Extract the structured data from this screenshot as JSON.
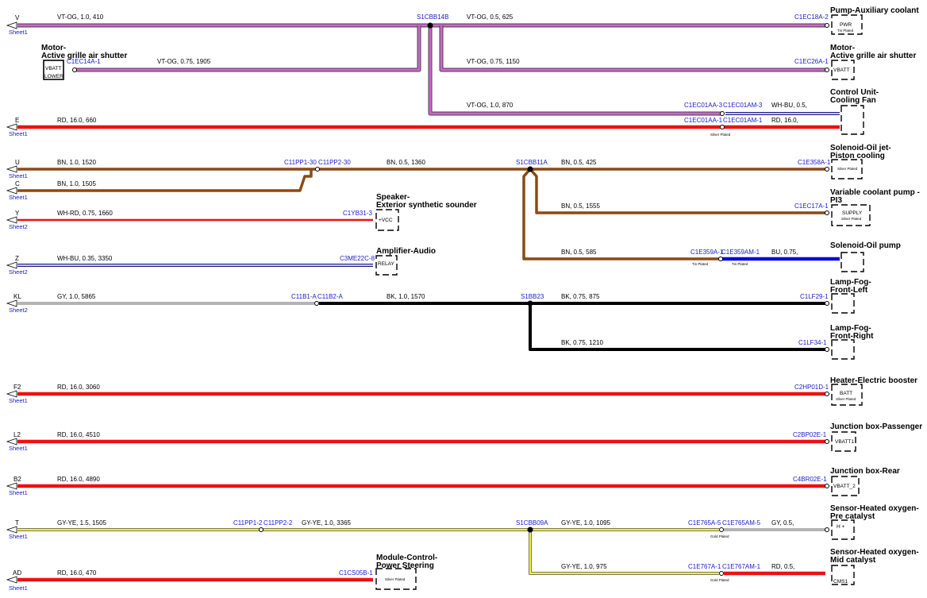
{
  "sheets": [
    "Sheet1",
    "Sheet2"
  ],
  "circuits": [
    {
      "letter": "V",
      "sheet": "Sheet1",
      "wire": "VT-OG, 1.0, 410"
    },
    {
      "letter": "E",
      "sheet": "Sheet1",
      "wire": "RD, 16.0, 660"
    },
    {
      "letter": "U",
      "sheet": "Sheet1",
      "wire": "BN, 1.0, 1520"
    },
    {
      "letter": "C",
      "sheet": "Sheet1",
      "wire": "BN, 1.0, 1505"
    },
    {
      "letter": "Y",
      "sheet": "Sheet2",
      "wire": "WH-RD, 0.75, 1660"
    },
    {
      "letter": "Z",
      "sheet": "Sheet2",
      "wire": "WH-BU, 0.35, 3350"
    },
    {
      "letter": "KL",
      "sheet": "Sheet2",
      "wire": "GY, 1.0, 5865"
    },
    {
      "letter": "F2",
      "sheet": "Sheet1",
      "wire": "RD, 16.0, 3060"
    },
    {
      "letter": "L2",
      "sheet": "Sheet1",
      "wire": "RD, 16.0, 4510"
    },
    {
      "letter": "B2",
      "sheet": "Sheet1",
      "wire": "RD, 16.0, 4890"
    },
    {
      "letter": "T",
      "sheet": "Sheet1",
      "wire": "GY-YE, 1.5, 1505"
    },
    {
      "letter": "AD",
      "sheet": "Sheet1",
      "wire": "RD, 16.0, 470"
    }
  ],
  "wires": {
    "v_a": "VT-OG, 0.5, 625",
    "v_b": "VT-OG, 0.75, 1905",
    "v_c": "VT-OG, 0.75, 1150",
    "v_d": "VT-OG, 1.0, 870",
    "cf_a": "WH-BU, 0.5,",
    "cf_b": "RD, 16.0,",
    "u_a": "BN, 0.5, 1360",
    "u_b": "BN, 0.5, 425",
    "u_c": "BN, 0.5, 1555",
    "u_d": "BN, 0.5, 585",
    "u_e": "BU, 0.75,",
    "kl_a": "BK, 1.0, 1570",
    "kl_b": "BK, 0.75, 875",
    "kl_c": "BK, 0.75, 1210",
    "t_a": "GY-YE, 1.0, 3365",
    "t_b": "GY-YE, 1.0, 1095",
    "t_c": "GY, 0.5,",
    "t_d": "GY-YE, 1.0, 975",
    "t_e": "RD, 0.5,"
  },
  "splices": {
    "v": "S1CBB14B",
    "u": "S1CBB11A",
    "kl": "S1BB23",
    "t": "S1CBB09A"
  },
  "connectors": {
    "c1ec18a": "C1EC18A-2",
    "c1ec14a": "C1EC14A-1",
    "c1ec26a": "C1EC26A-1",
    "c1ec01aa3": "C1EC01AA-3",
    "c1ec01am3": "C1EC01AM-3",
    "c1ec01aa1": "C1EC01AA-1",
    "c1ec01am1": "C1EC01AM-1",
    "c11pp1_30": "C11PP1-30",
    "c11pp2_30": "C11PP2-30",
    "c1e358a": "C1E358A-1",
    "c1yb31": "C1YB31-3",
    "c1ec17a": "C1EC17A-1",
    "c3me22c": "C3ME22C-8",
    "c1e359a": "C1E359A-1",
    "c1e359am": "C1E359AM-1",
    "c11b1": "C11B1-A",
    "c11b2": "C11B2-A",
    "c1lf29": "C1LF29-1",
    "c1lf34": "C1LF34-1",
    "c2hp01d": "C2HP01D-1",
    "c2bp02e": "C2BP02E-1",
    "c4br02e": "C4BR02E-1",
    "c11pp1_2": "C11PP1-2",
    "c11pp2_2": "C11PP2-2",
    "c1e765a": "C1E765A-5",
    "c1e765am": "C1E765AM-5",
    "c1e767a": "C1E767A-1",
    "c1e767am": "C1E767AM-1",
    "c1cs05b": "C1CS05B-1"
  },
  "devices": {
    "pump_aux": "Pump-Auxiliary coolant",
    "motor_l1": "Motor-",
    "motor_l2": "Active grille air shutter",
    "cf_l1": "Control Unit-",
    "cf_l2": "Cooling Fan",
    "sol_jet_l1": "Solenoid-Oil jet-",
    "sol_jet_l2": "Piston cooling",
    "spk_l1": "Speaker-",
    "spk_l2": "Exterior synthetic sounder",
    "vcp_l1": "Variable coolant pump -",
    "vcp_l2": "PI3",
    "amp": "Amplifier-Audio",
    "sol_pump": "Solenoid-Oil pump",
    "fog_l1": "Lamp-Fog-",
    "fog_l_l2": "Front-Left",
    "fog_r_l2": "Front-Right",
    "heater": "Heater-Electric booster",
    "jb_pass": "Junction box-Passenger",
    "jb_rear": "Junction box-Rear",
    "hos_l1": "Sensor-Heated oxygen-",
    "hos_pre_l2": "Pre catalyst",
    "hos_mid_l2": "Mid catalyst",
    "mcps_l1": "Module-Control-",
    "mcps_l2": "Power Steering"
  },
  "pins": {
    "pwr": "PWR",
    "vbatt": "VBATT",
    "lower": "LOWER",
    "vcc": "+VCC",
    "supply": "SUPPLY",
    "relay": "RELAY",
    "batt": "BATT",
    "vbatt1": "VBATT1",
    "vbatt_2": "VBATT_2",
    "hplus": "H +",
    "cms1": "CMS1"
  },
  "plating": {
    "tin": "Tin Plated",
    "silver": "Silver Plated",
    "gold": "Gold Plated"
  },
  "colors": {
    "VT-OG": "#cc66cc",
    "RD": "#ee1111",
    "BN": "#8b4a14",
    "WH-RD": "#ee1111",
    "WH-BU": "#1a1a88",
    "GY": "#b4b4b4",
    "BK": "#000000",
    "GY-YE": "#eeee44",
    "BU": "#0a0ae0"
  }
}
